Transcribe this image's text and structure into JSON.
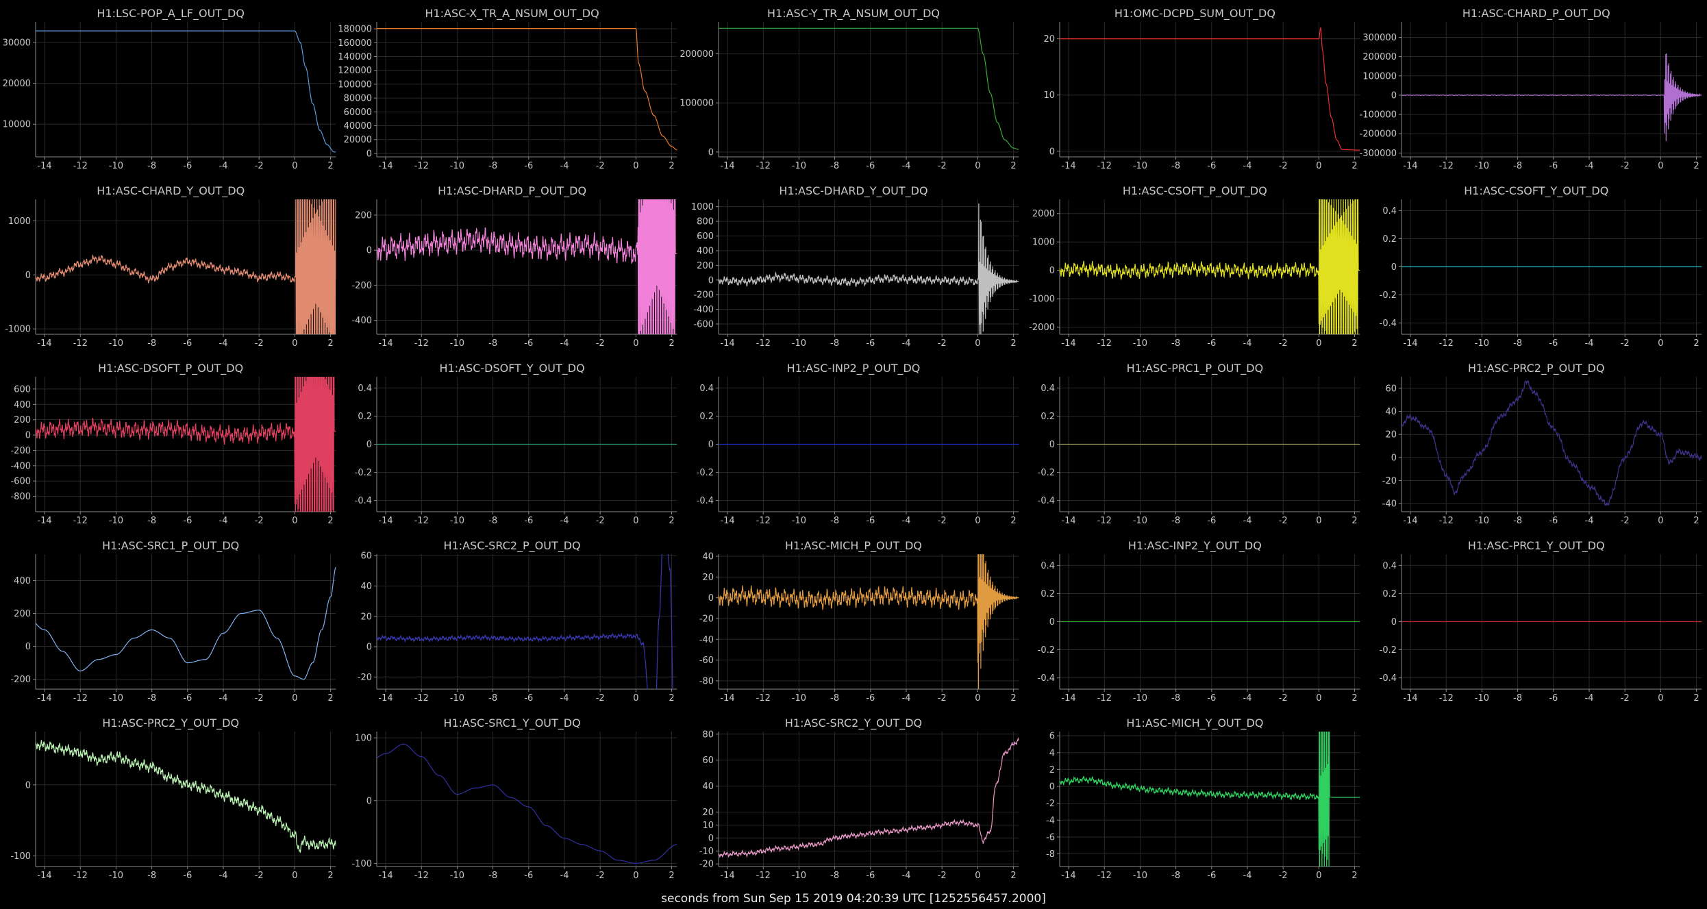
{
  "figure": {
    "background": "#000000",
    "grid_color": "#2a2a2a",
    "axis_color": "#8a8a8a",
    "text_color": "#c8c8c8",
    "xlabel": "seconds from Sun Sep 15 2019 04:20:39 UTC [1252556457.2000]"
  },
  "chart_data": [
    {
      "type": "line",
      "title": "H1:LSC-POP_A_LF_OUT_DQ",
      "color": "#5a9be0",
      "x": [
        -15,
        -12,
        -9,
        -6,
        -3,
        0,
        0.3,
        0.6,
        1,
        1.4,
        1.8,
        2.2
      ],
      "y": [
        32800,
        32800,
        32800,
        32800,
        32800,
        32800,
        30000,
        24000,
        15000,
        8500,
        5000,
        3200
      ],
      "ylim": [
        2000,
        35000
      ],
      "yticks": [
        10000,
        20000,
        30000
      ],
      "xlim": [
        -14.5,
        2.3
      ],
      "xticks": [
        -14,
        -12,
        -10,
        -8,
        -6,
        -4,
        -2,
        0,
        2
      ],
      "noise": 0,
      "burst": null
    },
    {
      "type": "line",
      "title": "H1:ASC-X_TR_A_NSUM_OUT_DQ",
      "color": "#e8782a",
      "x": [
        -15,
        -12,
        -9,
        -6,
        -3,
        0,
        0.15,
        0.5,
        1,
        1.5,
        2,
        2.3
      ],
      "y": [
        180500,
        180500,
        180500,
        180500,
        180500,
        180500,
        130000,
        90000,
        55000,
        25000,
        10000,
        5000
      ],
      "ylim": [
        -5000,
        190000
      ],
      "yticks": [
        0,
        20000,
        40000,
        60000,
        80000,
        100000,
        120000,
        140000,
        160000,
        180000
      ],
      "xlim": [
        -14.5,
        2.3
      ],
      "xticks": [
        -14,
        -12,
        -10,
        -8,
        -6,
        -4,
        -2,
        0,
        2
      ],
      "noise": 0,
      "burst": null
    },
    {
      "type": "line",
      "title": "H1:ASC-Y_TR_A_NSUM_OUT_DQ",
      "color": "#38a838",
      "x": [
        -15,
        -12,
        -9,
        -6,
        -3,
        0,
        0.3,
        0.7,
        1.1,
        1.5,
        2,
        2.3
      ],
      "y": [
        252000,
        252000,
        252000,
        252000,
        252000,
        252000,
        200000,
        120000,
        60000,
        25000,
        8000,
        5000
      ],
      "ylim": [
        -10000,
        265000
      ],
      "yticks": [
        0,
        100000,
        200000
      ],
      "xlim": [
        -14.5,
        2.3
      ],
      "xticks": [
        -14,
        -12,
        -10,
        -8,
        -6,
        -4,
        -2,
        0,
        2
      ],
      "noise": 0,
      "burst": null
    },
    {
      "type": "line",
      "title": "H1:OMC-DCPD_SUM_OUT_DQ",
      "color": "#e03030",
      "x": [
        -15,
        -12,
        -9,
        -6,
        -3,
        0,
        0.1,
        0.2,
        0.4,
        0.7,
        1,
        1.3,
        2.3
      ],
      "y": [
        20,
        20,
        20,
        20,
        20,
        20,
        22,
        18,
        12,
        6,
        2,
        0.3,
        0.2
      ],
      "ylim": [
        -1,
        23
      ],
      "yticks": [
        0,
        10,
        20
      ],
      "xlim": [
        -14.5,
        2.3
      ],
      "xticks": [
        -14,
        -12,
        -10,
        -8,
        -6,
        -4,
        -2,
        0,
        2
      ],
      "noise": 0,
      "burst": null
    },
    {
      "type": "line",
      "title": "H1:ASC-CHARD_P_OUT_DQ",
      "color": "#b070d0",
      "x": [
        -15,
        0,
        2.3
      ],
      "y": [
        0,
        0,
        0
      ],
      "ylim": [
        -320000,
        380000
      ],
      "yticks": [
        -300000,
        -200000,
        -100000,
        0,
        100000,
        200000,
        300000
      ],
      "xlim": [
        -14.5,
        2.3
      ],
      "xticks": [
        -14,
        -12,
        -10,
        -8,
        -6,
        -4,
        -2,
        0,
        2
      ],
      "noise": 1500,
      "burst": {
        "start": 0.2,
        "end": 2.2,
        "amp": 300000,
        "decay": true
      }
    },
    {
      "type": "line",
      "title": "H1:ASC-CHARD_Y_OUT_DQ",
      "color": "#e08a70",
      "x": [
        -15,
        -14,
        -13,
        -12,
        -11,
        -10,
        -9,
        -8,
        -7,
        -6,
        -5,
        -4,
        -3,
        -2,
        -1,
        0
      ],
      "y": [
        -50,
        -50,
        50,
        200,
        300,
        200,
        50,
        -80,
        150,
        250,
        180,
        100,
        50,
        -50,
        -10,
        -80
      ],
      "ylim": [
        -1100,
        1400
      ],
      "yticks": [
        -1000,
        0,
        1000
      ],
      "xlim": [
        -14.5,
        2.3
      ],
      "xticks": [
        -14,
        -12,
        -10,
        -8,
        -6,
        -4,
        -2,
        0,
        2
      ],
      "noise": 60,
      "burst": {
        "start": 0.05,
        "end": 2.3,
        "amp": 2000,
        "decay": false
      }
    },
    {
      "type": "line",
      "title": "H1:ASC-DHARD_P_OUT_DQ",
      "color": "#f080d8",
      "x": [
        -15,
        -13,
        -11,
        -9,
        -7,
        -5,
        -3,
        -1,
        0
      ],
      "y": [
        0,
        20,
        40,
        60,
        30,
        10,
        30,
        0,
        -20
      ],
      "ylim": [
        -480,
        290
      ],
      "yticks": [
        -400,
        -200,
        0,
        200
      ],
      "xlim": [
        -14.5,
        2.3
      ],
      "xticks": [
        -14,
        -12,
        -10,
        -8,
        -6,
        -4,
        -2,
        0,
        2
      ],
      "noise": 55,
      "burst": {
        "start": 0.1,
        "end": 2.2,
        "amp": 800,
        "decay": false
      }
    },
    {
      "type": "line",
      "title": "H1:ASC-DHARD_Y_OUT_DQ",
      "color": "#c0c0c0",
      "x": [
        -15,
        -13,
        -11,
        -9,
        -7,
        -5,
        -3,
        -1,
        0
      ],
      "y": [
        0,
        -20,
        40,
        0,
        -30,
        20,
        0,
        -10,
        -20
      ],
      "ylim": [
        -740,
        1100
      ],
      "yticks": [
        -600,
        -400,
        -200,
        0,
        200,
        400,
        600,
        800,
        1000
      ],
      "xlim": [
        -14.5,
        2.3
      ],
      "xticks": [
        -14,
        -12,
        -10,
        -8,
        -6,
        -4,
        -2,
        0,
        2
      ],
      "noise": 45,
      "burst": {
        "start": 0.05,
        "end": 2.2,
        "amp": 1200,
        "decay": true
      }
    },
    {
      "type": "line",
      "title": "H1:ASC-CSOFT_P_OUT_DQ",
      "color": "#e0e020",
      "x": [
        -15,
        -13,
        -11,
        -9,
        -7,
        -5,
        -3,
        -1,
        0
      ],
      "y": [
        0,
        50,
        -50,
        0,
        50,
        0,
        -30,
        20,
        0
      ],
      "ylim": [
        -2250,
        2500
      ],
      "yticks": [
        -2000,
        -1000,
        0,
        1000,
        2000
      ],
      "xlim": [
        -14.5,
        2.3
      ],
      "xticks": [
        -14,
        -12,
        -10,
        -8,
        -6,
        -4,
        -2,
        0,
        2
      ],
      "noise": 200,
      "burst": {
        "start": 0,
        "end": 2.2,
        "amp": 3000,
        "decay": false
      }
    },
    {
      "type": "line",
      "title": "H1:ASC-CSOFT_Y_OUT_DQ",
      "color": "#20b0c0",
      "x": [
        -15,
        2.3
      ],
      "y": [
        0,
        0
      ],
      "ylim": [
        -0.48,
        0.48
      ],
      "yticks": [
        -0.4,
        -0.2,
        0,
        0.2,
        0.4
      ],
      "xlim": [
        -14.5,
        2.3
      ],
      "xticks": [
        -14,
        -12,
        -10,
        -8,
        -6,
        -4,
        -2,
        0,
        2
      ],
      "noise": 0,
      "burst": null
    },
    {
      "type": "line",
      "title": "H1:ASC-DSOFT_P_OUT_DQ",
      "color": "#e04060",
      "x": [
        -15,
        -13,
        -11,
        -9,
        -7,
        -5,
        -3,
        -1,
        0
      ],
      "y": [
        50,
        80,
        100,
        60,
        80,
        20,
        0,
        40,
        50
      ],
      "ylim": [
        -1000,
        760
      ],
      "yticks": [
        -800,
        -600,
        -400,
        -200,
        0,
        200,
        400,
        600
      ],
      "xlim": [
        -14.5,
        2.3
      ],
      "xticks": [
        -14,
        -12,
        -10,
        -8,
        -6,
        -4,
        -2,
        0,
        2
      ],
      "noise": 90,
      "burst": {
        "start": 0,
        "end": 2.2,
        "amp": 1500,
        "decay": false
      }
    },
    {
      "type": "line",
      "title": "H1:ASC-DSOFT_Y_OUT_DQ",
      "color": "#28a080",
      "x": [
        -15,
        2.3
      ],
      "y": [
        0,
        0
      ],
      "ylim": [
        -0.48,
        0.48
      ],
      "yticks": [
        -0.4,
        -0.2,
        0,
        0.2,
        0.4
      ],
      "xlim": [
        -14.5,
        2.3
      ],
      "xticks": [
        -14,
        -12,
        -10,
        -8,
        -6,
        -4,
        -2,
        0,
        2
      ],
      "noise": 0,
      "burst": null
    },
    {
      "type": "line",
      "title": "H1:ASC-INP2_P_OUT_DQ",
      "color": "#2030d0",
      "x": [
        -15,
        2.3
      ],
      "y": [
        0,
        0
      ],
      "ylim": [
        -0.48,
        0.48
      ],
      "yticks": [
        -0.4,
        -0.2,
        0,
        0.2,
        0.4
      ],
      "xlim": [
        -14.5,
        2.3
      ],
      "xticks": [
        -14,
        -12,
        -10,
        -8,
        -6,
        -4,
        -2,
        0,
        2
      ],
      "noise": 0,
      "burst": null
    },
    {
      "type": "line",
      "title": "H1:ASC-PRC1_P_OUT_DQ",
      "color": "#a0a060",
      "x": [
        -15,
        2.3
      ],
      "y": [
        0,
        0
      ],
      "ylim": [
        -0.48,
        0.48
      ],
      "yticks": [
        -0.4,
        -0.2,
        0,
        0.2,
        0.4
      ],
      "xlim": [
        -14.5,
        2.3
      ],
      "xticks": [
        -14,
        -12,
        -10,
        -8,
        -6,
        -4,
        -2,
        0,
        2
      ],
      "noise": 0,
      "burst": null
    },
    {
      "type": "line",
      "title": "H1:ASC-PRC2_P_OUT_DQ",
      "color": "#40308a",
      "x": [
        -15,
        -14,
        -13,
        -12,
        -11.5,
        -11,
        -10,
        -9,
        -8,
        -7.5,
        -7,
        -6,
        -5,
        -4,
        -3,
        -2,
        -1,
        0,
        0.5,
        1,
        2.3
      ],
      "y": [
        20,
        35,
        25,
        -15,
        -30,
        -15,
        5,
        35,
        50,
        65,
        55,
        25,
        -5,
        -25,
        -40,
        0,
        30,
        20,
        -5,
        5,
        0
      ],
      "ylim": [
        -47,
        70
      ],
      "yticks": [
        -40,
        -20,
        0,
        20,
        40,
        60
      ],
      "xlim": [
        -14.5,
        2.3
      ],
      "xticks": [
        -14,
        -12,
        -10,
        -8,
        -6,
        -4,
        -2,
        0,
        2
      ],
      "noise": 2,
      "burst": null
    },
    {
      "type": "line",
      "title": "H1:ASC-SRC1_P_OUT_DQ",
      "color": "#80b0f0",
      "x": [
        -15,
        -14,
        -13,
        -12,
        -11,
        -10,
        -9,
        -8,
        -7,
        -6,
        -5,
        -4,
        -3,
        -2,
        -1,
        0,
        0.5,
        1,
        1.5,
        2,
        2.3
      ],
      "y": [
        180,
        100,
        -30,
        -150,
        -80,
        -50,
        50,
        100,
        50,
        -100,
        -80,
        80,
        200,
        220,
        50,
        -180,
        -200,
        -100,
        100,
        300,
        480
      ],
      "ylim": [
        -260,
        560
      ],
      "yticks": [
        -200,
        0,
        200,
        400
      ],
      "xlim": [
        -14.5,
        2.3
      ],
      "xticks": [
        -14,
        -12,
        -10,
        -8,
        -6,
        -4,
        -2,
        0,
        2
      ],
      "noise": 0,
      "burst": null
    },
    {
      "type": "line",
      "title": "H1:ASC-SRC2_P_OUT_DQ",
      "color": "#3838b0",
      "x": [
        -15,
        -12,
        -9,
        -6,
        -3,
        -1,
        0,
        0.4,
        0.7,
        1,
        1.3,
        1.6,
        1.9,
        2.2
      ],
      "y": [
        6,
        5,
        6,
        5,
        6,
        7,
        7,
        2,
        -30,
        -80,
        20,
        100,
        50,
        -100
      ],
      "ylim": [
        -28,
        61
      ],
      "yticks": [
        -20,
        0,
        20,
        40,
        60
      ],
      "xlim": [
        -14.5,
        2.3
      ],
      "xticks": [
        -14,
        -12,
        -10,
        -8,
        -6,
        -4,
        -2,
        0,
        2
      ],
      "noise": 1.2,
      "burst": null
    },
    {
      "type": "line",
      "title": "H1:ASC-MICH_P_OUT_DQ",
      "color": "#e09a40",
      "x": [
        -15,
        -13,
        -11,
        -9,
        -7,
        -5,
        -3,
        -1,
        0
      ],
      "y": [
        0,
        2,
        0,
        -2,
        0,
        2,
        0,
        -2,
        0
      ],
      "ylim": [
        -88,
        42
      ],
      "yticks": [
        -80,
        -60,
        -40,
        -20,
        0,
        20,
        40
      ],
      "xlim": [
        -14.5,
        2.3
      ],
      "xticks": [
        -14,
        -12,
        -10,
        -8,
        -6,
        -4,
        -2,
        0,
        2
      ],
      "noise": 7,
      "burst": {
        "start": 0,
        "end": 2.2,
        "amp": 100,
        "decay": true
      }
    },
    {
      "type": "line",
      "title": "H1:ASC-INP2_Y_OUT_DQ",
      "color": "#38a030",
      "x": [
        -15,
        2.3
      ],
      "y": [
        0,
        0
      ],
      "ylim": [
        -0.48,
        0.48
      ],
      "yticks": [
        -0.4,
        -0.2,
        0,
        0.2,
        0.4
      ],
      "xlim": [
        -14.5,
        2.3
      ],
      "xticks": [
        -14,
        -12,
        -10,
        -8,
        -6,
        -4,
        -2,
        0,
        2
      ],
      "noise": 0,
      "burst": null
    },
    {
      "type": "line",
      "title": "H1:ASC-PRC1_Y_OUT_DQ",
      "color": "#c02828",
      "x": [
        -15,
        2.3
      ],
      "y": [
        0,
        0
      ],
      "ylim": [
        -0.48,
        0.48
      ],
      "yticks": [
        -0.4,
        -0.2,
        0,
        0.2,
        0.4
      ],
      "xlim": [
        -14.5,
        2.3
      ],
      "xticks": [
        -14,
        -12,
        -10,
        -8,
        -6,
        -4,
        -2,
        0,
        2
      ],
      "noise": 0,
      "burst": null
    },
    {
      "type": "line",
      "title": "H1:ASC-PRC2_Y_OUT_DQ",
      "color": "#b8f0b0",
      "x": [
        -15,
        -14,
        -13,
        -12,
        -11,
        -10,
        -9,
        -8,
        -7,
        -6,
        -5,
        -4,
        -3,
        -2,
        -1,
        0,
        0.2,
        0.5,
        1,
        2.3
      ],
      "y": [
        60,
        55,
        50,
        45,
        35,
        40,
        30,
        25,
        10,
        0,
        -5,
        -15,
        -25,
        -35,
        -50,
        -70,
        -90,
        -80,
        -85,
        -82
      ],
      "ylim": [
        -115,
        75
      ],
      "yticks": [
        -100,
        0
      ],
      "xlim": [
        -14.5,
        2.3
      ],
      "xticks": [
        -14,
        -12,
        -10,
        -8,
        -6,
        -4,
        -2,
        0,
        2
      ],
      "noise": 6,
      "burst": null
    },
    {
      "type": "line",
      "title": "H1:ASC-SRC1_Y_OUT_DQ",
      "color": "#3030a0",
      "x": [
        -15,
        -14,
        -13,
        -12,
        -11,
        -10,
        -9,
        -8,
        -7,
        -6,
        -5,
        -4,
        -3,
        -2,
        -1,
        0,
        1,
        2.3
      ],
      "y": [
        60,
        75,
        90,
        70,
        40,
        10,
        20,
        25,
        5,
        -10,
        -40,
        -60,
        -70,
        -80,
        -95,
        -100,
        -95,
        -70
      ],
      "ylim": [
        -105,
        110
      ],
      "yticks": [
        -100,
        0,
        100
      ],
      "xlim": [
        -14.5,
        2.3
      ],
      "xticks": [
        -14,
        -12,
        -10,
        -8,
        -6,
        -4,
        -2,
        0,
        2
      ],
      "noise": 0,
      "burst": null
    },
    {
      "type": "line",
      "title": "H1:ASC-SRC2_Y_OUT_DQ",
      "color": "#e898c8",
      "x": [
        -15,
        -13,
        -11,
        -9,
        -8,
        -7,
        -5,
        -3,
        -1,
        0,
        0.3,
        0.7,
        1,
        1.5,
        2,
        2.3
      ],
      "y": [
        -13,
        -12,
        -8,
        -5,
        0,
        2,
        5,
        8,
        12,
        10,
        -2,
        5,
        40,
        65,
        72,
        76
      ],
      "ylim": [
        -22,
        82
      ],
      "yticks": [
        -20,
        -10,
        0,
        10,
        20,
        40,
        60,
        80
      ],
      "xlim": [
        -14.5,
        2.3
      ],
      "xticks": [
        -14,
        -12,
        -10,
        -8,
        -6,
        -4,
        -2,
        0,
        2
      ],
      "noise": 1.5,
      "burst": null
    },
    {
      "type": "line",
      "title": "H1:ASC-MICH_Y_OUT_DQ",
      "color": "#30d060",
      "x": [
        -15,
        -13,
        -11,
        -9,
        -7,
        -5,
        -3,
        -1,
        0,
        1,
        2.3
      ],
      "y": [
        0.5,
        0.8,
        0,
        -0.5,
        -0.8,
        -1,
        -1,
        -1.2,
        -1.2,
        -1.3,
        -1.3
      ],
      "ylim": [
        -9.5,
        6.5
      ],
      "yticks": [
        -8,
        -6,
        -4,
        -2,
        0,
        2,
        4,
        6
      ],
      "xlim": [
        -14.5,
        2.3
      ],
      "xticks": [
        -14,
        -12,
        -10,
        -8,
        -6,
        -4,
        -2,
        0,
        2
      ],
      "noise": 0.3,
      "burst": {
        "start": 0,
        "end": 0.6,
        "amp": 10,
        "decay": false
      }
    }
  ]
}
